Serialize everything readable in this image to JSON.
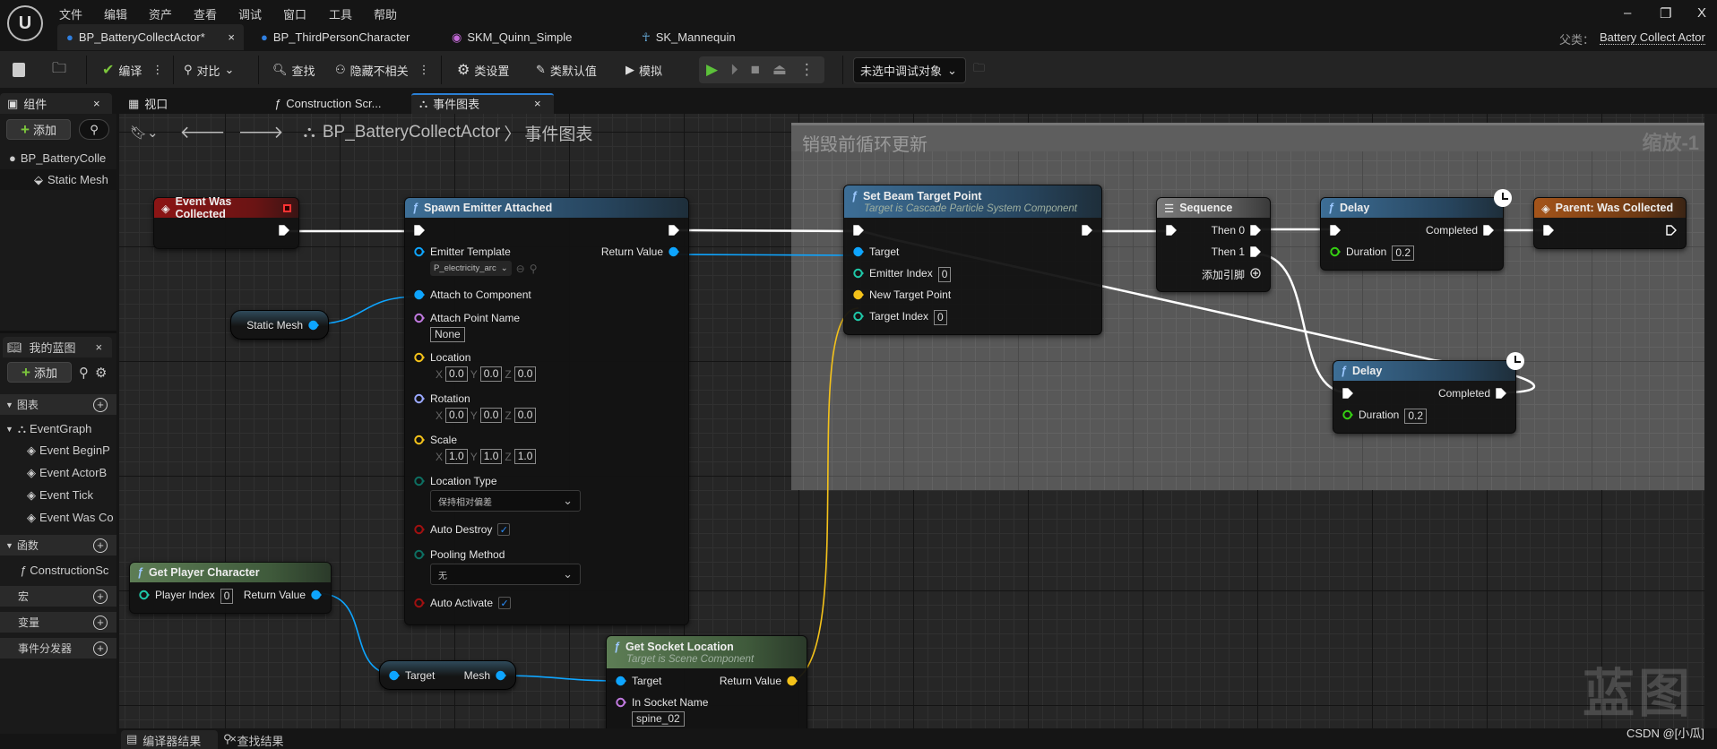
{
  "menu": [
    "文件",
    "编辑",
    "资产",
    "查看",
    "调试",
    "窗口",
    "工具",
    "帮助"
  ],
  "window_controls": {
    "minimize": "–",
    "restore": "❐",
    "close": "X"
  },
  "tabs": [
    {
      "label": "BP_BatteryCollectActor*",
      "icon": "blueprint-actor-icon",
      "active": true,
      "close": "×"
    },
    {
      "label": "BP_ThirdPersonCharacter",
      "icon": "blueprint-character-icon"
    },
    {
      "label": "SKM_Quinn_Simple",
      "icon": "skeletal-mesh-icon"
    },
    {
      "label": "SK_Mannequin",
      "icon": "skeleton-icon"
    }
  ],
  "parent_class": {
    "label": "父类：",
    "value": "Battery Collect Actor"
  },
  "toolbar": {
    "compile": "编译",
    "diff": "对比",
    "find": "查找",
    "hide_unrelated": "隐藏不相关",
    "class_settings": "类设置",
    "class_defaults": "类默认值",
    "simulate": "模拟",
    "debug_target": "未选中调试对象"
  },
  "panel_tabs": {
    "components": "组件",
    "viewport": "视口",
    "construction": "Construction Scr...",
    "event_graph": "事件图表",
    "close": "×"
  },
  "components": {
    "add": "添加",
    "items": [
      "BP_BatteryColle",
      "Static Mesh"
    ]
  },
  "my_blueprint": {
    "title": "我的蓝图",
    "add": "添加",
    "sections": {
      "graphs": "图表",
      "functions": "函数",
      "macros": "宏",
      "variables": "变量",
      "dispatchers": "事件分发器"
    },
    "event_graph": "EventGraph",
    "events": [
      "Event BeginP",
      "Event ActorB",
      "Event Tick",
      "Event Was Co"
    ],
    "functions": [
      "ConstructionSc"
    ]
  },
  "breadcrumb": {
    "blueprint": "BP_BatteryCollectActor",
    "sep": "〉",
    "graph": "事件图表"
  },
  "comment": {
    "title": "销毁前循环更新",
    "zoom": "缩放-1"
  },
  "watermark": "蓝图",
  "credit": "CSDN @[小瓜]",
  "bottom_tabs": {
    "compiler": "编译器结果",
    "find": "查找结果"
  },
  "pin_colors": {
    "exec": "#ffffff",
    "object": "#0ea5ff",
    "vector": "#f4c21a",
    "rotator": "#9aa8ff",
    "name": "#c17ae0",
    "int": "#1fc8a8",
    "enum": "#0d6f62",
    "bool": "#a01010",
    "float": "#35d012"
  },
  "var_nodes": [
    {
      "id": "static_mesh",
      "right": {
        "label": "Static Mesh",
        "type": "object",
        "connected": true
      }
    },
    {
      "id": "get_mesh",
      "left": {
        "label": "Target",
        "type": "object",
        "connected": true
      },
      "right": {
        "label": "Mesh",
        "type": "object",
        "connected": true
      }
    }
  ],
  "nodes": [
    {
      "id": "event",
      "kind": "event",
      "icon": "event-icon",
      "title": "Event Was Collected",
      "rows": [
        {
          "r": {
            "type": "exec",
            "connected": true
          }
        }
      ]
    },
    {
      "id": "spawn",
      "kind": "func",
      "icon": "function-icon",
      "title": "Spawn Emitter Attached",
      "rows": [
        {
          "l": {
            "type": "exec",
            "connected": true
          },
          "r": {
            "type": "exec",
            "connected": true
          }
        },
        {
          "l": {
            "type": "object",
            "label": "Emitter Template",
            "asset": "P_electricity_arc"
          },
          "r": {
            "type": "object",
            "label": "Return Value",
            "connected": true
          }
        },
        {
          "l": {
            "type": "object",
            "label": "Attach to Component",
            "connected": true
          }
        },
        {
          "l": {
            "type": "name",
            "label": "Attach Point Name",
            "text": "None"
          }
        },
        {
          "l": {
            "type": "vector",
            "label": "Location",
            "vec": [
              "0.0",
              "0.0",
              "0.0"
            ]
          }
        },
        {
          "l": {
            "type": "rotator",
            "label": "Rotation",
            "vec": [
              "0.0",
              "0.0",
              "0.0"
            ]
          }
        },
        {
          "l": {
            "type": "vector",
            "label": "Scale",
            "vec": [
              "1.0",
              "1.0",
              "1.0"
            ]
          }
        },
        {
          "l": {
            "type": "enum",
            "label": "Location Type",
            "select": "保持相对偏差"
          }
        },
        {
          "l": {
            "type": "bool",
            "label": "Auto Destroy",
            "check": true
          }
        },
        {
          "l": {
            "type": "enum",
            "label": "Pooling Method",
            "select": "无"
          }
        },
        {
          "l": {
            "type": "bool",
            "label": "Auto Activate",
            "check": true
          }
        }
      ]
    },
    {
      "id": "beam",
      "kind": "func",
      "icon": "function-icon",
      "title": "Set Beam Target Point",
      "subtitle": "Target is Cascade Particle System Component",
      "rows": [
        {
          "l": {
            "type": "exec",
            "connected": true
          },
          "r": {
            "type": "exec",
            "connected": true
          }
        },
        {
          "l": {
            "type": "object",
            "label": "Target",
            "connected": true
          }
        },
        {
          "l": {
            "type": "int",
            "label": "Emitter Index",
            "num": "0"
          }
        },
        {
          "l": {
            "type": "vector",
            "label": "New Target Point",
            "connected": true
          }
        },
        {
          "l": {
            "type": "int",
            "label": "Target Index",
            "num": "0"
          }
        }
      ]
    },
    {
      "id": "seq",
      "kind": "seq",
      "icon": "sequence-icon",
      "title": "Sequence",
      "rows": [
        {
          "l": {
            "type": "exec",
            "connected": true
          },
          "r": {
            "type": "exec",
            "label": "Then 0",
            "connected": true
          }
        },
        {
          "r": {
            "type": "exec",
            "label": "Then 1",
            "connected": true
          }
        },
        {
          "r": {
            "type": "add",
            "label": "添加引脚"
          }
        }
      ]
    },
    {
      "id": "delay1",
      "kind": "func",
      "icon": "function-icon",
      "title": "Delay",
      "latent": true,
      "rows": [
        {
          "l": {
            "type": "exec",
            "connected": true
          },
          "r": {
            "type": "exec",
            "label": "Completed",
            "connected": true
          }
        },
        {
          "l": {
            "type": "float",
            "label": "Duration",
            "num": "0.2"
          }
        }
      ]
    },
    {
      "id": "parent",
      "kind": "parent",
      "icon": "event-icon",
      "title": "Parent: Was Collected",
      "rows": [
        {
          "l": {
            "type": "exec",
            "connected": true
          },
          "r": {
            "type": "exec",
            "connected": false
          }
        }
      ]
    },
    {
      "id": "delay2",
      "kind": "func",
      "icon": "function-icon",
      "title": "Delay",
      "latent": true,
      "rows": [
        {
          "l": {
            "type": "exec",
            "connected": true
          },
          "r": {
            "type": "exec",
            "label": "Completed",
            "connected": true
          }
        },
        {
          "l": {
            "type": "float",
            "label": "Duration",
            "num": "0.2"
          }
        }
      ]
    },
    {
      "id": "player",
      "kind": "pure",
      "icon": "function-icon",
      "title": "Get Player Character",
      "rows": [
        {
          "l": {
            "type": "int",
            "label": "Player Index",
            "num": "0"
          },
          "r": {
            "type": "object",
            "label": "Return Value",
            "connected": true
          }
        }
      ]
    },
    {
      "id": "socket",
      "kind": "pure",
      "icon": "function-icon",
      "title": "Get Socket Location",
      "subtitle": "Target is Scene Component",
      "rows": [
        {
          "l": {
            "type": "object",
            "label": "Target",
            "connected": true
          },
          "r": {
            "type": "vector",
            "label": "Return Value",
            "connected": true
          }
        },
        {
          "l": {
            "type": "name",
            "label": "In Socket Name",
            "text": "spine_02"
          }
        }
      ]
    }
  ]
}
